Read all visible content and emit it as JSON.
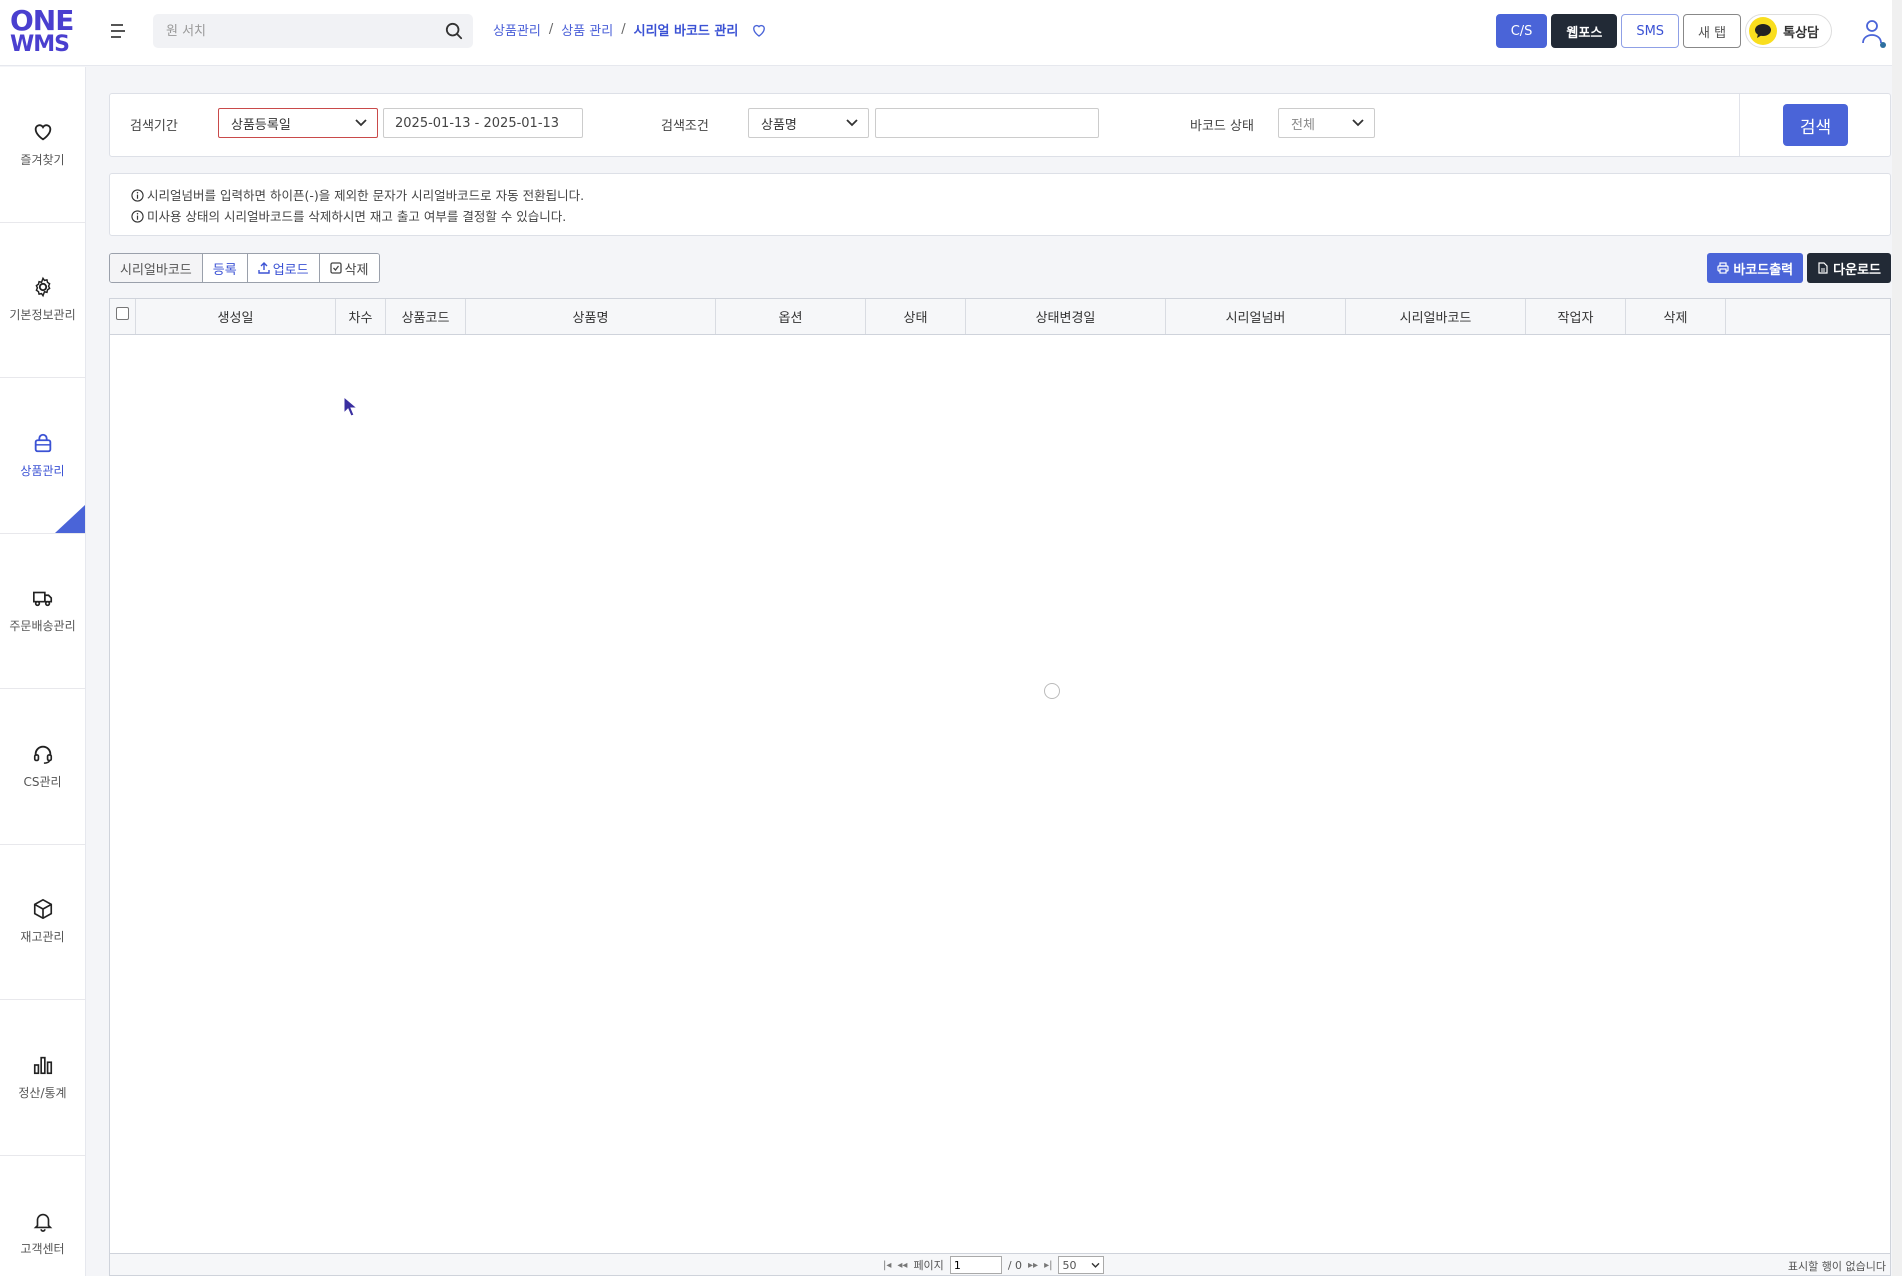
{
  "header": {
    "logo_line1": "ONE",
    "logo_line2": "WMS",
    "search_placeholder": "원 서치",
    "breadcrumb": [
      "상품관리",
      "상품 관리",
      "시리얼 바코드 관리"
    ],
    "breadcrumb_sep": "/",
    "buttons": {
      "cs": "C/S",
      "webpos": "웹포스",
      "sms": "SMS",
      "newtab": "새 탭",
      "talk": "톡상담"
    }
  },
  "sidebar": {
    "items": [
      {
        "label": "즐겨찾기",
        "icon": "heart-icon"
      },
      {
        "label": "기본정보관리",
        "icon": "gear-icon"
      },
      {
        "label": "상품관리",
        "icon": "bag-icon",
        "active": true
      },
      {
        "label": "주문배송관리",
        "icon": "truck-icon"
      },
      {
        "label": "CS관리",
        "icon": "headset-icon"
      },
      {
        "label": "재고관리",
        "icon": "box-icon"
      },
      {
        "label": "정산/통계",
        "icon": "bar-chart-icon"
      },
      {
        "label": "고객센터",
        "icon": "bell-icon"
      }
    ]
  },
  "search": {
    "period_label": "검색기간",
    "period_type": "상품등록일",
    "date_range": "2025-01-13 - 2025-01-13",
    "condition_label": "검색조건",
    "condition_type": "상품명",
    "condition_value": "",
    "barcode_status_label": "바코드 상태",
    "barcode_status": "전체",
    "search_button": "검색"
  },
  "info": {
    "lines": [
      "시리얼넘버를 입력하면 하이픈(-)을 제외한 문자가 시리얼바코드로 자동 전환됩니다.",
      "미사용 상태의 시리얼바코드를 삭제하시면 재고 출고 여부를 결정할 수 있습니다."
    ]
  },
  "toolbar": {
    "group_label": "시리얼바코드",
    "register": "등록",
    "upload": "업로드",
    "delete": "삭제",
    "print_barcode": "바코드출력",
    "download": "다운로드"
  },
  "grid": {
    "columns": [
      "생성일",
      "차수",
      "상품코드",
      "상품명",
      "옵션",
      "상태",
      "상태변경일",
      "시리얼넘버",
      "시리얼바코드",
      "작업자",
      "삭제"
    ],
    "rows": []
  },
  "pager": {
    "page_label": "페이지",
    "current_page": "1",
    "total_pages": "/ 0",
    "page_size": "50",
    "empty_text": "표시할 행이 없습니다"
  },
  "colors": {
    "accent": "#4a64d8",
    "dark": "#222a36",
    "kakao": "#f9de1e"
  }
}
